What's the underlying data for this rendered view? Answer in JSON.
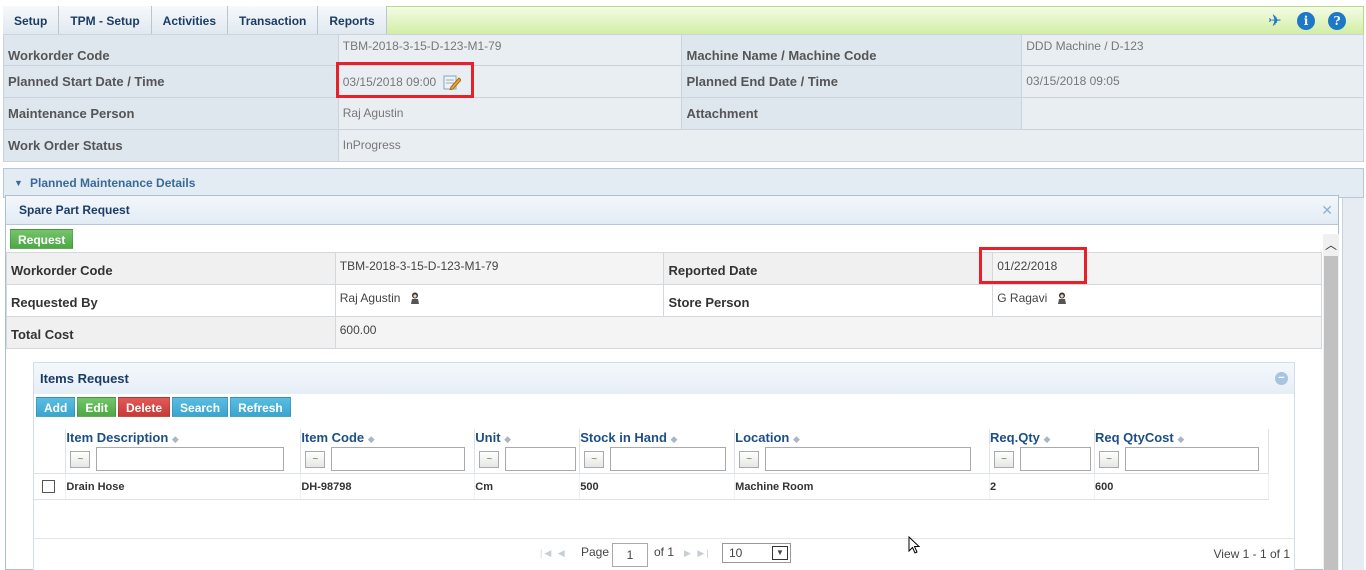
{
  "menu": {
    "items": [
      {
        "label": "Setup"
      },
      {
        "label": "TPM - Setup"
      },
      {
        "label": "Activities"
      },
      {
        "label": "Transaction"
      },
      {
        "label": "Reports"
      }
    ],
    "icons": [
      "pin-icon",
      "info-icon",
      "help-icon"
    ],
    "info_glyph": "i",
    "help_glyph": "?"
  },
  "workorder": {
    "rows": [
      {
        "label1": "Workorder Code",
        "value1": "TBM-2018-3-15-D-123-M1-79",
        "label2": "Machine Name / Machine Code",
        "value2": "DDD Machine / D-123"
      },
      {
        "label1": "Planned Start Date / Time",
        "value1": "03/15/2018 09:00",
        "label2": "Planned End Date / Time",
        "value2": "03/15/2018 09:05"
      },
      {
        "label1": "Maintenance Person",
        "value1": "Raj Agustin",
        "label2": "Attachment",
        "value2": ""
      },
      {
        "label1": "Work Order Status",
        "value1": "InProgress"
      }
    ]
  },
  "planned_maintenance": {
    "title": "Planned Maintenance Details"
  },
  "dialog": {
    "title": "Spare Part Request",
    "close_glyph": "✕",
    "request_button": "Request",
    "fields": {
      "workorder_code_label": "Workorder Code",
      "workorder_code": "TBM-2018-3-15-D-123-M1-79",
      "reported_date_label": "Reported Date",
      "reported_date": "01/22/2018",
      "requested_by_label": "Requested By",
      "requested_by": "Raj Agustin",
      "store_person_label": "Store Person",
      "store_person": "G Ragavi",
      "total_cost_label": "Total Cost",
      "total_cost": "600.00"
    }
  },
  "items_request": {
    "title": "Items Request",
    "toolbar": {
      "add": "Add",
      "edit": "Edit",
      "delete": "Delete",
      "search": "Search",
      "refresh": "Refresh"
    },
    "columns": [
      "Item Description",
      "Item Code",
      "Unit",
      "Stock in Hand",
      "Location",
      "Req.Qty",
      "Req QtyCost"
    ],
    "filter_glyph": "~",
    "rows": [
      {
        "item_description": "Drain Hose",
        "item_code": "DH-98798",
        "unit": "Cm",
        "stock_in_hand": "500",
        "location": "Machine Room",
        "req_qty": "2",
        "req_qty_cost": "600"
      }
    ],
    "pager": {
      "page_label": "Page",
      "page": "1",
      "of_label": "of 1",
      "rows_per_page": "10",
      "view_text": "View 1 - 1 of 1"
    }
  },
  "colors": {
    "accent": "#1e78c8",
    "highlight": "#e8202a",
    "header_text": "#1d4f86"
  }
}
